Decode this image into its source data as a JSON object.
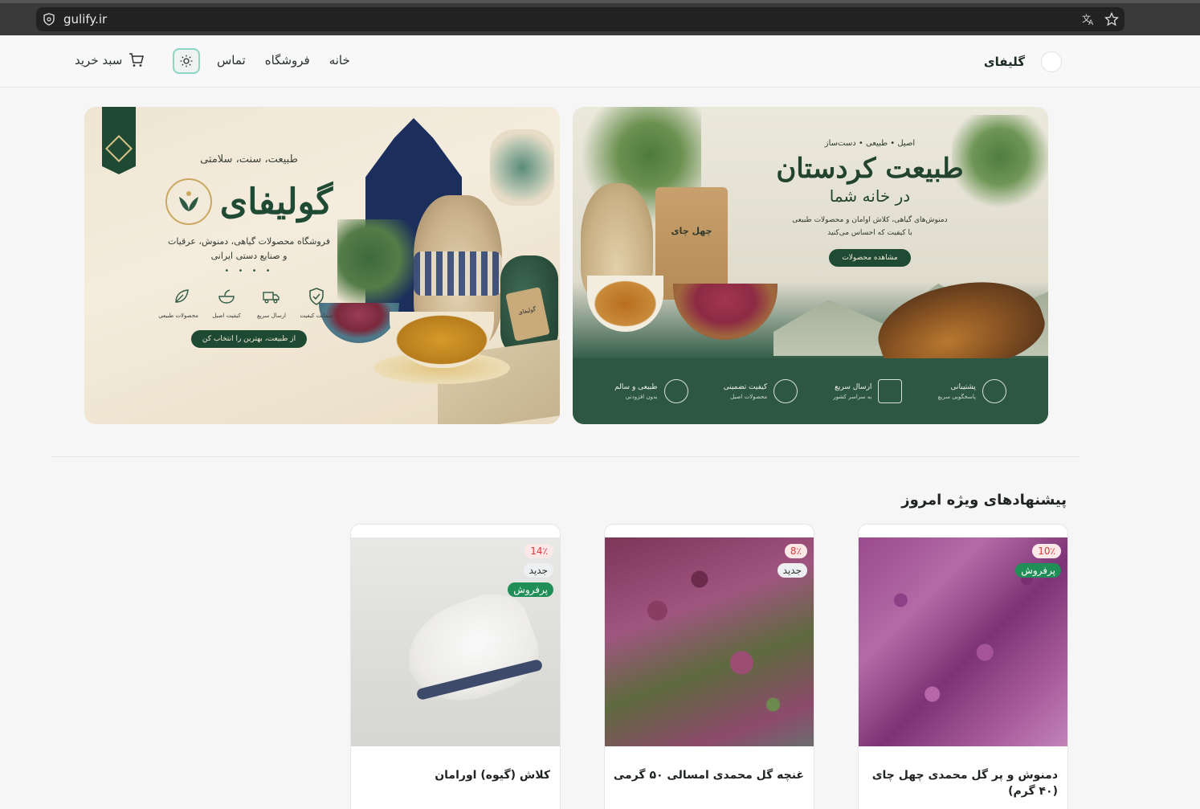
{
  "browser": {
    "url": "gulify.ir"
  },
  "header": {
    "brand_name": "گلیفای",
    "nav": [
      "خانه",
      "فروشگاه",
      "تماس"
    ],
    "cart_label": "سبد خرید"
  },
  "banners": {
    "left": {
      "tagline": "طبیعت، سنت، سلامتی",
      "title": "گولیفای",
      "subtitle_line1": "فروشگاه محصولات گیاهی، دمنوش، عرقیات",
      "subtitle_line2": "و صنایع دستی ایرانی",
      "features": [
        "ضمانت کیفیت",
        "ارسال سریع",
        "کیفیت اصیل",
        "محصولات طبیعی"
      ],
      "cta": "از طبیعت، بهترین را انتخاب کن",
      "bottle_tag": "گولیفای"
    },
    "right": {
      "tagline": "اصیل • طبیعی • دست‌ساز",
      "title": "طبیعت کردستان",
      "subtitle": "در خانه شما",
      "desc_line1": "دمنوش‌های گیاهی، کلاش اوامان و محصولات طبیعی",
      "desc_line2": "با کیفیت که احساس می‌کنید",
      "cta": "مشاهده محصولات",
      "bag_label": "چهل چای",
      "features": [
        {
          "title": "پشتیبانی",
          "sub": "پاسخگویی سریع"
        },
        {
          "title": "ارسال سریع",
          "sub": "به سراسر کشور"
        },
        {
          "title": "کیفیت تضمینی",
          "sub": "محصولات اصیل"
        },
        {
          "title": "طبیعی و سالم",
          "sub": "بدون افزودنی"
        }
      ]
    }
  },
  "section": {
    "title": "پیشنهادهای ویژه امروز"
  },
  "products": [
    {
      "title": "دمنوش و پر گل محمدی چهل چای (۴۰ گرم)",
      "discount": "10٪",
      "badges": [
        "پرفروش"
      ]
    },
    {
      "title": "غنچه گل محمدی امسالی ۵۰ گرمی",
      "discount": "8٪",
      "badges": [
        "جدید"
      ]
    },
    {
      "title": "کلاش (گیوه) اورامان",
      "discount": "14٪",
      "badges": [
        "جدید",
        "پرفروش"
      ]
    }
  ]
}
